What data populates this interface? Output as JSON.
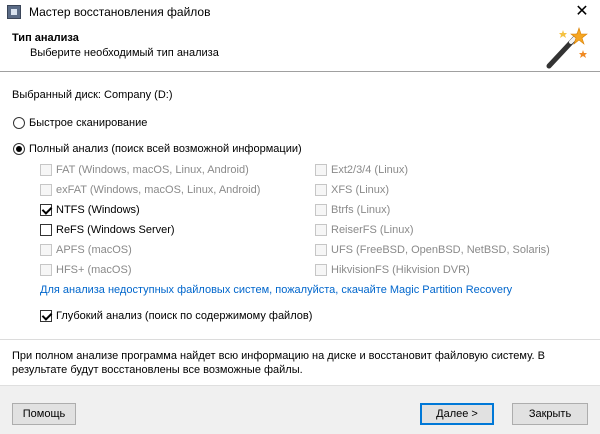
{
  "window": {
    "title": "Мастер восстановления файлов",
    "close_glyph": "✕"
  },
  "header": {
    "title": "Тип анализа",
    "subtitle": "Выберите необходимый тип анализа",
    "icon": "magic-wand-icon"
  },
  "disk": {
    "label": "Выбранный диск: Company (D:)"
  },
  "modes": {
    "quick": {
      "label": "Быстрое сканирование",
      "selected": false
    },
    "full": {
      "label": "Полный анализ (поиск всей возможной информации)",
      "selected": true
    }
  },
  "filesystems": {
    "left": [
      {
        "label": "FAT (Windows, macOS, Linux, Android)",
        "checked": false,
        "enabled": false
      },
      {
        "label": "exFAT (Windows, macOS, Linux, Android)",
        "checked": false,
        "enabled": false
      },
      {
        "label": "NTFS (Windows)",
        "checked": true,
        "enabled": true
      },
      {
        "label": "ReFS (Windows Server)",
        "checked": false,
        "enabled": true
      },
      {
        "label": "APFS (macOS)",
        "checked": false,
        "enabled": false
      },
      {
        "label": "HFS+ (macOS)",
        "checked": false,
        "enabled": false
      }
    ],
    "right": [
      {
        "label": "Ext2/3/4 (Linux)",
        "checked": false,
        "enabled": false
      },
      {
        "label": "XFS (Linux)",
        "checked": false,
        "enabled": false
      },
      {
        "label": "Btrfs (Linux)",
        "checked": false,
        "enabled": false
      },
      {
        "label": "ReiserFS (Linux)",
        "checked": false,
        "enabled": false
      },
      {
        "label": "UFS (FreeBSD, OpenBSD, NetBSD, Solaris)",
        "checked": false,
        "enabled": false
      },
      {
        "label": "HikvisionFS (Hikvision DVR)",
        "checked": false,
        "enabled": false
      }
    ]
  },
  "link": {
    "text": "Для анализа недоступных файловых систем, пожалуйста, скачайте Magic Partition Recovery"
  },
  "deep_scan": {
    "label": "Глубокий анализ (поиск по содержимому файлов)",
    "checked": true
  },
  "info": {
    "text": "При полном анализе программа найдет всю информацию на диске и восстановит файловую систему. В результате будут восстановлены все возможные файлы."
  },
  "buttons": {
    "help": "Помощь",
    "next": "Далее >",
    "close": "Закрыть"
  },
  "colors": {
    "link": "#0066cc",
    "default_button_border": "#0078d7"
  }
}
